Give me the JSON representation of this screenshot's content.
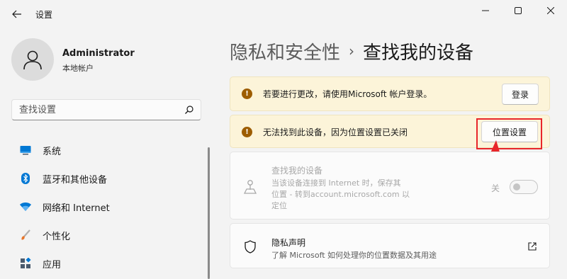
{
  "window": {
    "title": "设置"
  },
  "user": {
    "name": "Administrator",
    "account_type": "本地帐户"
  },
  "search": {
    "placeholder": "查找设置"
  },
  "sidebar": {
    "items": [
      {
        "label": "系统",
        "icon": "monitor-icon",
        "color": "#0078d4"
      },
      {
        "label": "蓝牙和其他设备",
        "icon": "bluetooth-icon",
        "color": "#0078d4"
      },
      {
        "label": "网络和 Internet",
        "icon": "wifi-icon",
        "color": "#0078d4"
      },
      {
        "label": "个性化",
        "icon": "brush-icon",
        "color": "#e8752a"
      },
      {
        "label": "应用",
        "icon": "apps-icon",
        "color": "#4a5b6e"
      }
    ]
  },
  "breadcrumb": {
    "parent": "隐私和安全性",
    "separator": "›",
    "current": "查找我的设备"
  },
  "cards": {
    "signin_warning": {
      "text": "若要进行更改，请使用Microsoft 帐户登录。",
      "button": "登录"
    },
    "location_warning": {
      "text": "无法找到此设备，因为位置设置已关闭",
      "button": "位置设置"
    },
    "find_device": {
      "title": "查找我的设备",
      "desc_line1": "当该设备连接到 Internet 时，保存其",
      "desc_line2": "位置 - 转到account.microsoft.com 以",
      "desc_line3": "定位",
      "toggle_label": "关",
      "toggle_on": false
    },
    "privacy": {
      "title": "隐私声明",
      "desc": "了解 Microsoft 如何处理你的位置数据及其用途"
    }
  },
  "colors": {
    "accent": "#0078d4",
    "warning_bg": "#fcf4d9",
    "warning_icon": "#9d5d00",
    "annotation_red": "#e8262a"
  }
}
